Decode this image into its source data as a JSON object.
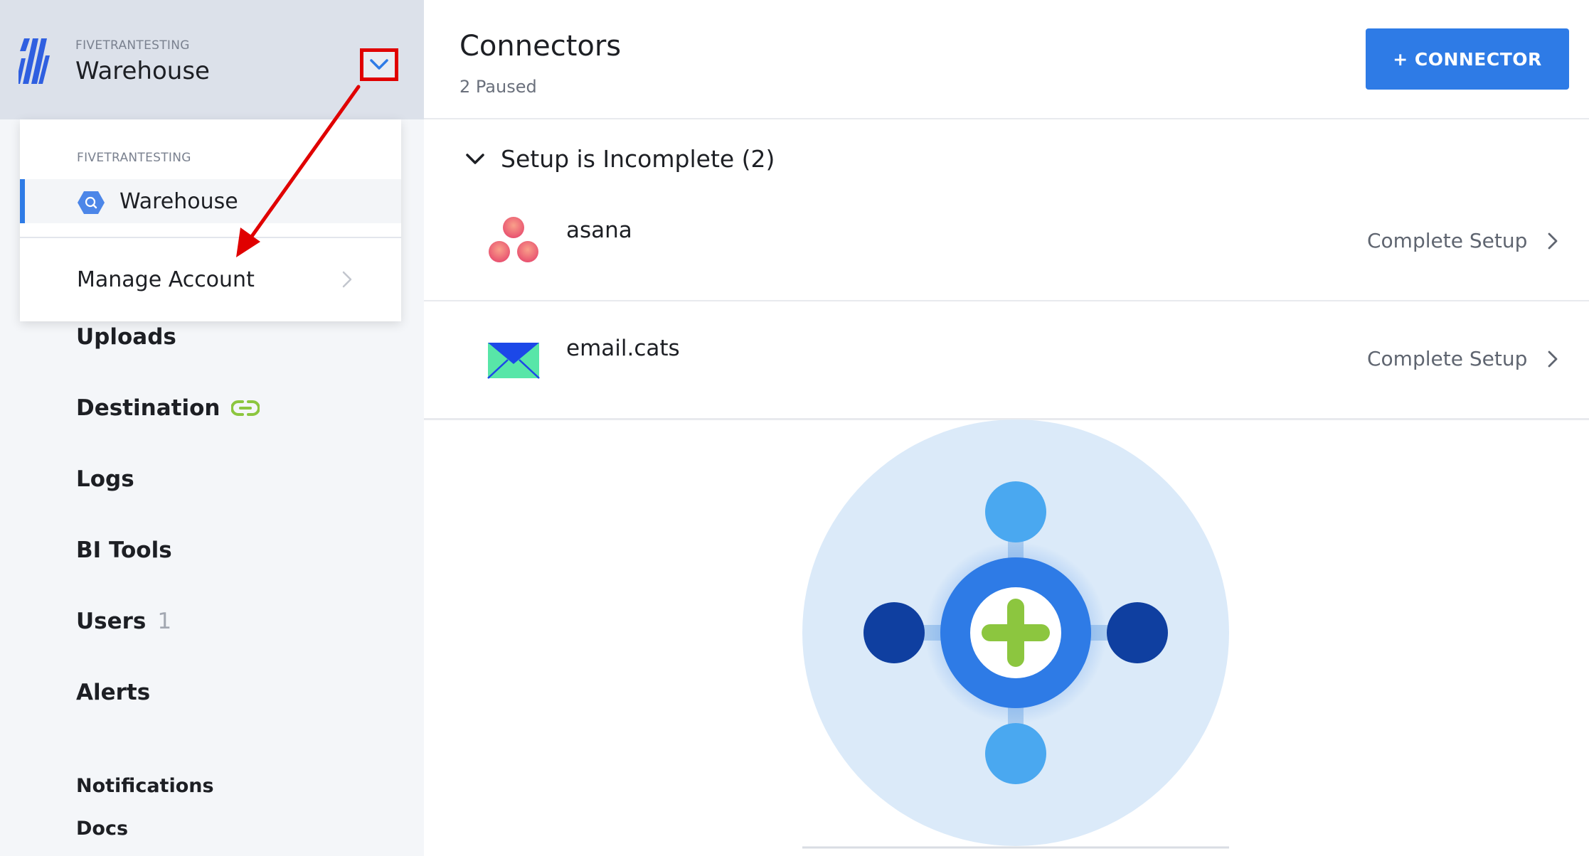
{
  "sidebar": {
    "org_label": "FIVETRANTESTING",
    "title": "Warehouse",
    "nav": [
      {
        "label": "Uploads"
      },
      {
        "label": "Destination"
      },
      {
        "label": "Logs"
      },
      {
        "label": "BI Tools"
      },
      {
        "label": "Users",
        "count": "1"
      },
      {
        "label": "Alerts"
      },
      {
        "label": "Notifications"
      },
      {
        "label": "Docs"
      }
    ]
  },
  "dropdown": {
    "org_label": "FIVETRANTESTING",
    "selected_label": "Warehouse",
    "manage_label": "Manage Account"
  },
  "main": {
    "title": "Connectors",
    "subtitle": "2 Paused",
    "add_button": "+ CONNECTOR",
    "section_label": "Setup is Incomplete (2)",
    "connectors": [
      {
        "name": "asana",
        "action": "Complete Setup",
        "icon": "asana-logo-icon"
      },
      {
        "name": "email.cats",
        "action": "Complete Setup",
        "icon": "email-envelope-icon"
      }
    ]
  },
  "colors": {
    "accent": "#2e7be6",
    "sidebar_bg": "#f4f6f9",
    "sidebar_header_bg": "#dce1ea",
    "annotation_red": "#e00000",
    "link_green": "#8cc63f"
  }
}
